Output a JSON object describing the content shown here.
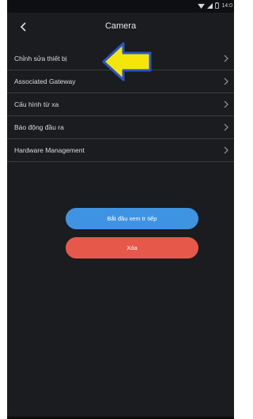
{
  "status_bar": {
    "time": "14:0"
  },
  "header": {
    "title": "Camera"
  },
  "menu": {
    "items": [
      {
        "label": "Chỉnh sửa thiết bị"
      },
      {
        "label": "Associated Gateway"
      },
      {
        "label": "Cấu hình từ xa"
      },
      {
        "label": "Báo động đầu ra"
      },
      {
        "label": "Hardware Management"
      }
    ]
  },
  "buttons": {
    "live_label": "Bắt đầu xem tr tiếp",
    "delete_label": "Xóa"
  },
  "colors": {
    "background": "#1b1c1f",
    "live_button": "#3f93e3",
    "delete_button": "#e6584a",
    "annotation_arrow": "#f5e60a",
    "annotation_arrow_outline": "#2a55c9"
  },
  "icons": {
    "back": "back-arrow-icon",
    "chevron": "chevron-right-icon",
    "wifi": "wifi-icon",
    "signal": "signal-icon",
    "battery": "battery-icon"
  }
}
